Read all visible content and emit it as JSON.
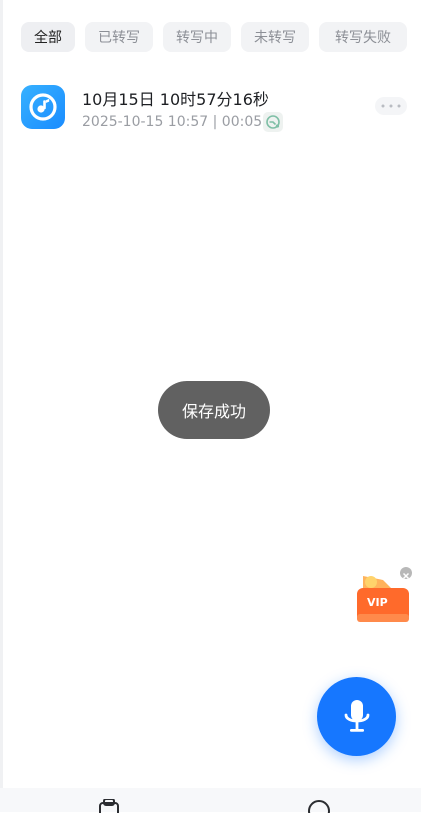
{
  "filters": [
    {
      "label": "全部",
      "active": true
    },
    {
      "label": "已转写",
      "active": false
    },
    {
      "label": "转写中",
      "active": false
    },
    {
      "label": "未转写",
      "active": false
    },
    {
      "label": "转写失败",
      "active": false
    }
  ],
  "record": {
    "title": "10月15日 10时57分16秒",
    "datetime": "2025-10-15 10:57",
    "separator": "|",
    "duration": "00:05"
  },
  "toast": {
    "message": "保存成功"
  },
  "vip_badge": {
    "label": "VIP"
  },
  "colors": {
    "accent": "#1677ff",
    "toast_bg": "#616161",
    "vip_orange": "#ff6a2b"
  }
}
